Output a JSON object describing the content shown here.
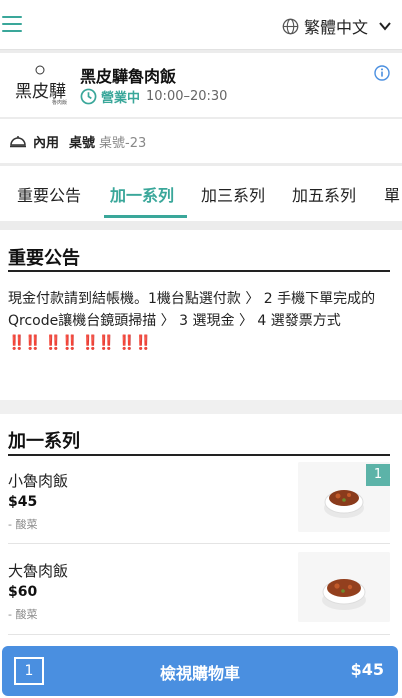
{
  "header": {
    "language": "繁體中文"
  },
  "store": {
    "name": "黑皮驊魯肉飯",
    "status": "營業中",
    "hours": "10:00–20:30"
  },
  "table": {
    "dine_mode": "內用",
    "label": "桌號",
    "number": "桌號-23"
  },
  "tabs": [
    {
      "label": "重要公告"
    },
    {
      "label": "加一系列"
    },
    {
      "label": "加三系列"
    },
    {
      "label": "加五系列"
    },
    {
      "label": "單"
    }
  ],
  "active_tab": "加一系列",
  "notice": {
    "title": "重要公告",
    "body": "現金付款請到結帳機。1機台點選付款 〉 2 手機下單完成的Qrcode讓機台鏡頭掃描 〉 3 選現金 〉 4 選發票方式",
    "emphasis": "‼️‼️ ‼️‼️ ‼️‼️ ‼️‼️"
  },
  "menu_section": {
    "title": "加一系列",
    "items": [
      {
        "name": "小魯肉飯",
        "price": "$45",
        "desc": "- 酸菜",
        "qty": "1"
      },
      {
        "name": "大魯肉飯",
        "price": "$60",
        "desc": "- 酸菜"
      }
    ]
  },
  "cart": {
    "count": "1",
    "label": "檢視購物車",
    "total": "$45"
  },
  "colors": {
    "accent": "#3aa79a",
    "cart": "#4a8fe0"
  }
}
